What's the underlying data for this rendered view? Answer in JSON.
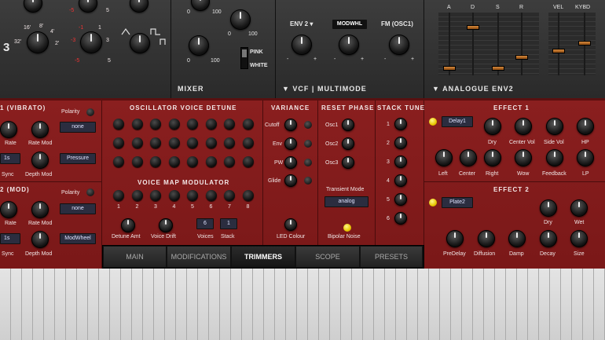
{
  "top": {
    "osc_row_label": "3",
    "osc_feet": [
      "16'",
      "8'",
      "4'",
      "32'",
      "2'"
    ],
    "osc_scale_a": [
      "-3",
      "3"
    ],
    "osc_scale_b": [
      "-5",
      "5",
      "-1",
      "1"
    ],
    "osc_scale_c": [
      "-5",
      "5"
    ],
    "mixer": {
      "title": "MIXER",
      "scale": [
        "0",
        "100",
        "0",
        "100",
        "0",
        "100",
        "0",
        "100"
      ],
      "noise_opts": [
        "PINK",
        "WHITE"
      ]
    },
    "vcf": {
      "title": "VCF | MULTIMODE",
      "labels": [
        "ENV 2",
        "MODWHL",
        "FM (OSC1)"
      ],
      "scale": [
        "-",
        "+",
        "-",
        "+",
        "-",
        "+"
      ]
    },
    "env": {
      "title": "ANALOGUE ENV2",
      "labels": [
        "A",
        "D",
        "S",
        "R",
        "VEL",
        "KYBD"
      ]
    }
  },
  "lfo1": {
    "title": "1 (VIBRATO)",
    "polarity": "Polarity",
    "polarity_value": "none",
    "rate": "Rate",
    "rate_mod": "Rate Mod",
    "sync": "Sync",
    "sync_value": "1s",
    "depth_mod": "Depth Mod",
    "mod_source": "Pressure"
  },
  "lfo2": {
    "title": "2 (MOD)",
    "polarity": "Polarity",
    "polarity_value": "none",
    "rate": "Rate",
    "rate_mod": "Rate Mod",
    "sync": "Sync",
    "sync_value": "1s",
    "depth_mod": "Depth Mod",
    "mod_source": "ModWheel"
  },
  "detune": {
    "title": "OSCILLATOR VOICE DETUNE"
  },
  "vmap": {
    "title": "VOICE MAP MODULATOR",
    "numbers": [
      "1",
      "2",
      "3",
      "4",
      "5",
      "6",
      "7",
      "8"
    ],
    "detune_amt": "Detune Amt",
    "voice_drift": "Voice Drift",
    "voices": "Voices",
    "voices_value": "6",
    "stack": "Stack",
    "stack_value": "1"
  },
  "variance": {
    "title": "VARIANCE",
    "items": [
      "Cutoff",
      "Env",
      "PW",
      "Glide"
    ],
    "led_colour": "LED Colour"
  },
  "reset_phase": {
    "title": "RESET PHASE",
    "items": [
      "Osc1",
      "Osc2",
      "Osc3"
    ],
    "transient_mode": "Transient Mode",
    "transient_value": "analog",
    "bipolar_noise": "Bipolar Noise"
  },
  "stack_tune": {
    "title": "STACK TUNE",
    "numbers": [
      "1",
      "2",
      "3",
      "4",
      "5",
      "6"
    ]
  },
  "effect1": {
    "title": "EFFECT 1",
    "type": "Delay1",
    "row1": [
      "Dry",
      "Center Vol",
      "Side Vol",
      "HP"
    ],
    "row2": [
      "Left",
      "Center",
      "Right",
      "Wow",
      "Feedback",
      "LP"
    ]
  },
  "effect2": {
    "title": "EFFECT 2",
    "type": "Plate2",
    "row1": [
      "Dry",
      "Wet"
    ],
    "row2": [
      "PreDelay",
      "Diffusion",
      "Damp",
      "Decay",
      "Size"
    ]
  },
  "tabs": [
    "MAIN",
    "MODIFICATIONS",
    "TRIMMERS",
    "SCOPE",
    "PRESETS"
  ],
  "active_tab": "TRIMMERS",
  "colors": {
    "panel_red": "#7f1b1b",
    "accent_led": "#e7c600",
    "slider_orange": "#d88a3c"
  }
}
